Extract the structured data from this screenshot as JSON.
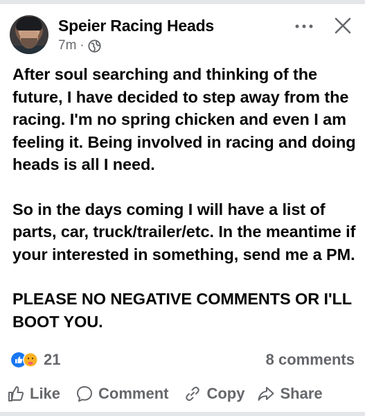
{
  "post": {
    "author": "Speier Racing Heads",
    "time": "7m",
    "separator": "·",
    "visibility_icon": "globe-icon",
    "more_icon": "ellipsis-icon",
    "close_icon": "close-icon",
    "paragraphs": [
      "After soul searching and thinking of the future, I have decided to step away from the racing. I'm no spring chicken and even I am feeling it. Being involved in racing and doing heads is all I need.",
      "So in the days coming I will have a list of parts, car, truck/trailer/etc. In the meantime if your interested in something, send me a PM.",
      "PLEASE NO NEGATIVE COMMENTS OR I'LL BOOT YOU."
    ]
  },
  "stats": {
    "reaction_icons": [
      "like-reaction-icon",
      "care-reaction-icon"
    ],
    "reaction_count": "21",
    "comments": "8 comments"
  },
  "actions": {
    "like": "Like",
    "comment": "Comment",
    "copy": "Copy",
    "share": "Share"
  },
  "colors": {
    "text": "#050505",
    "secondary": "#65676b",
    "like_blue": "#1877f2",
    "care_yellow": "#f7b125"
  }
}
